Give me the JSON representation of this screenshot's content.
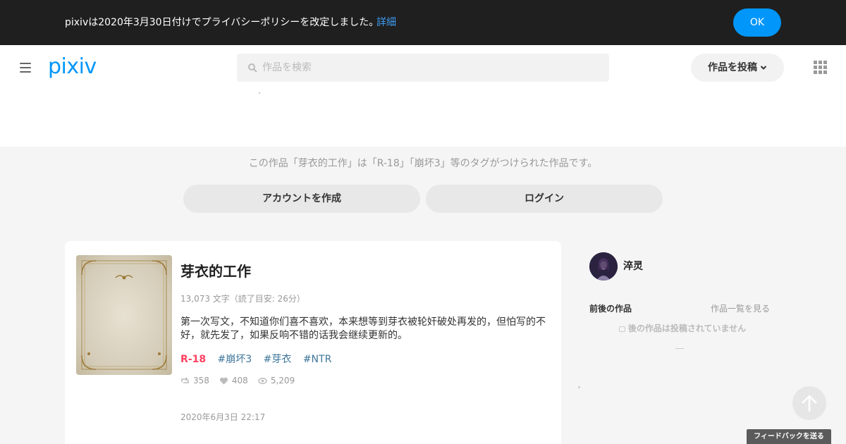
{
  "privacy_banner": {
    "message": "pixivは2020年3月30日付けでプライバシーポリシーを改定しました。",
    "details_link": "詳細",
    "ok_button": "OK"
  },
  "header": {
    "logo": "pixiv",
    "search_placeholder": "作品を検索",
    "post_button": "作品を投稿",
    "icons": [
      "menu-icon",
      "search-icon",
      "chevron-down-icon",
      "apps-grid-icon"
    ]
  },
  "signup_prompt": {
    "message": "この作品「芽衣的工作」は「R-18」「崩坏3」等のタグがつけられた作品です。",
    "create_account_button": "アカウントを作成",
    "login_button": "ログイン"
  },
  "work": {
    "title": "芽衣的工作",
    "meta": "13,073 文字（読了目安: 26分）",
    "description": "第一次写文，不知道你们喜不喜欢，本来想等到芽衣被轮奸破处再发的，但怕写的不好，就先发了，如果反响不错的话我会继续更新的。",
    "tags": [
      "R-18",
      "#崩坏3",
      "#芽衣",
      "#NTR"
    ],
    "stats": {
      "retweets": "358",
      "likes": "408",
      "views": "5,209"
    },
    "date": "2020年6月3日 22:17"
  },
  "sidebar": {
    "author_name": "淬灵",
    "adjacent_works_heading": "前後の作品",
    "view_list_link": "作品一覧を見る",
    "no_next_work": "後の作品は投稿されていません"
  },
  "feedback_button": "フィードバックを送る",
  "colors": {
    "banner_bg": "#1f1f1f",
    "accent": "#0096fa",
    "r18_tag": "#ff4060",
    "tag_link": "#3d7699"
  }
}
